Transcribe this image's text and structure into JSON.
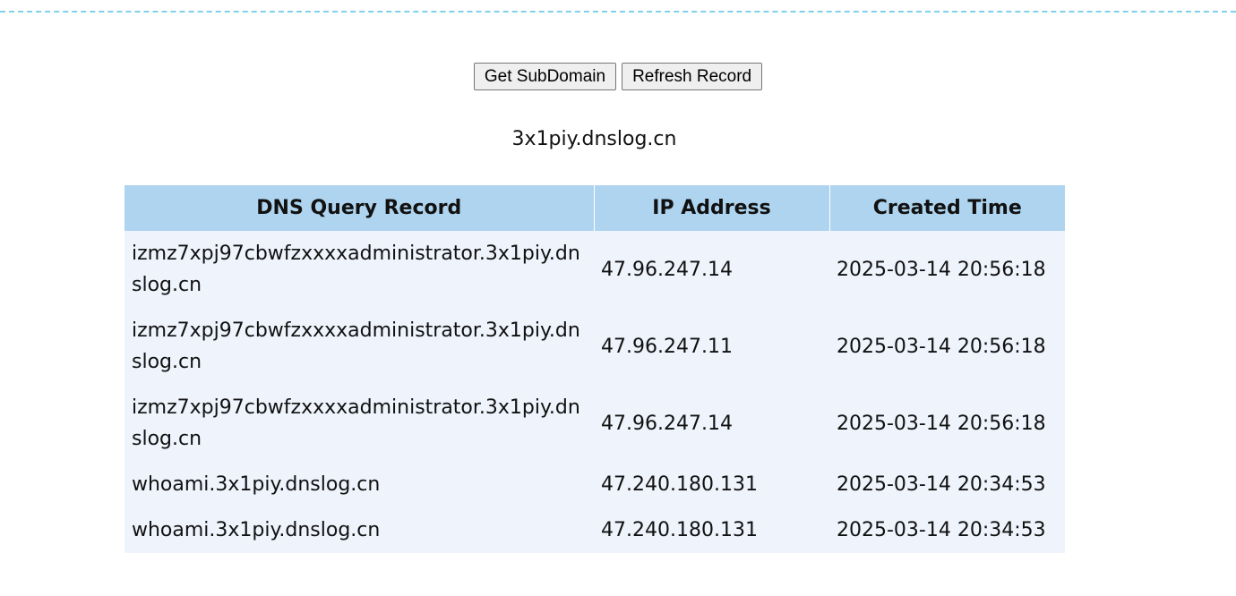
{
  "toolbar": {
    "get_subdomain_label": "Get SubDomain",
    "refresh_record_label": "Refresh Record"
  },
  "subdomain": "3x1piy.dnslog.cn",
  "table": {
    "headers": [
      "DNS Query Record",
      "IP Address",
      "Created Time"
    ],
    "rows": [
      {
        "record": "izmz7xpj97cbwfzxxxxadministrator.3x1piy.dnslog.cn",
        "ip": "47.96.247.14",
        "time": "2025-03-14 20:56:18"
      },
      {
        "record": "izmz7xpj97cbwfzxxxxadministrator.3x1piy.dnslog.cn",
        "ip": "47.96.247.11",
        "time": "2025-03-14 20:56:18"
      },
      {
        "record": "izmz7xpj97cbwfzxxxxadministrator.3x1piy.dnslog.cn",
        "ip": "47.96.247.14",
        "time": "2025-03-14 20:56:18"
      },
      {
        "record": "whoami.3x1piy.dnslog.cn",
        "ip": "47.240.180.131",
        "time": "2025-03-14 20:34:53"
      },
      {
        "record": "whoami.3x1piy.dnslog.cn",
        "ip": "47.240.180.131",
        "time": "2025-03-14 20:34:53"
      }
    ]
  }
}
